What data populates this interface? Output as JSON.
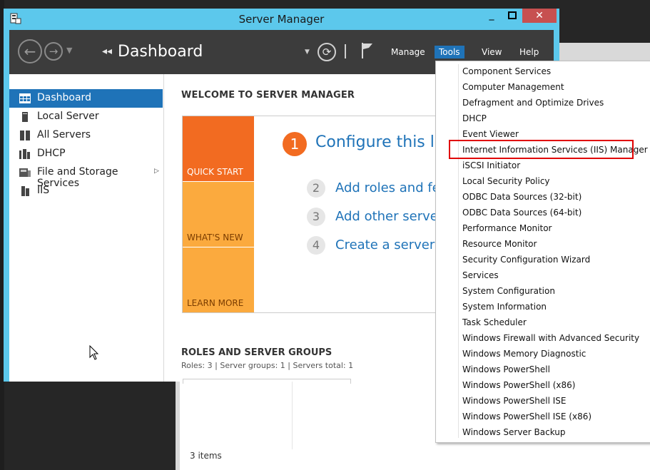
{
  "window": {
    "title": "Server Manager",
    "minimize": "_",
    "close": "✕"
  },
  "header": {
    "breadcrumb_arrows": "◂◂",
    "breadcrumb_title": "Dashboard",
    "menus": {
      "manage": "Manage",
      "tools": "Tools",
      "view": "View",
      "help": "Help"
    }
  },
  "sidebar": {
    "items": [
      {
        "label": "Dashboard",
        "icon": "dashboard-grid-icon",
        "selected": true
      },
      {
        "label": "Local Server",
        "icon": "local-server-icon"
      },
      {
        "label": "All Servers",
        "icon": "all-servers-icon"
      },
      {
        "label": "DHCP",
        "icon": "dhcp-icon"
      },
      {
        "label": "File and Storage Services",
        "icon": "file-storage-icon",
        "has_submenu": true
      },
      {
        "label": "IIS",
        "icon": "iis-icon"
      }
    ]
  },
  "main": {
    "welcome_heading": "WELCOME TO SERVER MANAGER",
    "tiles": {
      "quick_start": "QUICK START",
      "whats_new": "WHAT'S NEW",
      "learn_more": "LEARN MORE"
    },
    "steps": [
      {
        "num": "1",
        "text": "Configure this loc"
      },
      {
        "num": "2",
        "text": "Add roles and feat"
      },
      {
        "num": "3",
        "text": "Add other servers"
      },
      {
        "num": "4",
        "text": "Create a server gr"
      }
    ],
    "roles_heading": "ROLES AND SERVER GROUPS",
    "roles_meta": "Roles: 3   |   Server groups: 1   |   Servers total: 1"
  },
  "tools_menu": {
    "items": [
      "Component Services",
      "Computer Management",
      "Defragment and Optimize Drives",
      "DHCP",
      "Event Viewer",
      "Internet Information Services (IIS) Manager",
      "iSCSI Initiator",
      "Local Security Policy",
      "ODBC Data Sources (32-bit)",
      "ODBC Data Sources (64-bit)",
      "Performance Monitor",
      "Resource Monitor",
      "Security Configuration Wizard",
      "Services",
      "System Configuration",
      "System Information",
      "Task Scheduler",
      "Windows Firewall with Advanced Security",
      "Windows Memory Diagnostic",
      "Windows PowerShell",
      "Windows PowerShell (x86)",
      "Windows PowerShell ISE",
      "Windows PowerShell ISE (x86)",
      "Windows Server Backup"
    ],
    "highlighted_item": "Internet Information Services (IIS) Manager"
  },
  "background_window": {
    "status": "3 items"
  },
  "colors": {
    "title_bar": "#5cc8ec",
    "header": "#3c3c3c",
    "accent": "#1f73b8",
    "quick_start": "#f26b21",
    "tile_light": "#fbaa3e",
    "highlight_border": "#e00000"
  }
}
